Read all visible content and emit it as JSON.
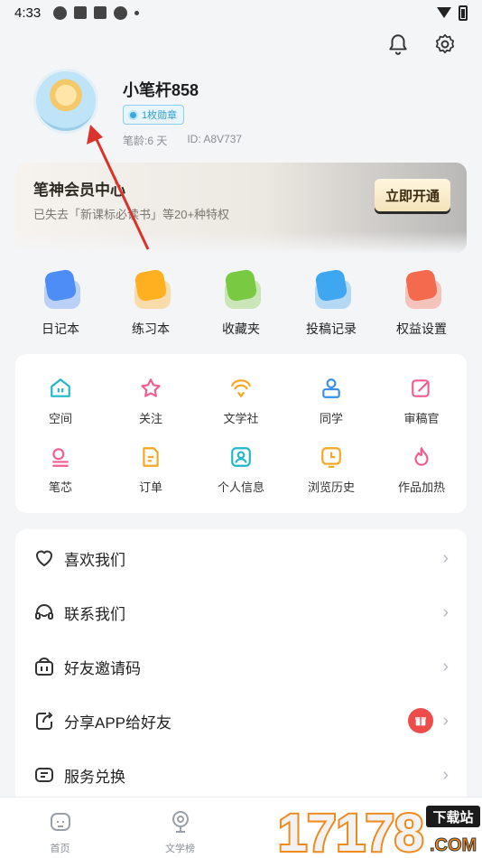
{
  "status_bar": {
    "time": "4:33"
  },
  "profile": {
    "username": "小笔杆858",
    "badge": "1枚勋章",
    "age": "笔龄:6 天",
    "id": "ID: A8V737"
  },
  "vip": {
    "title": "笔神会员中心",
    "subtitle": "已失去「新课标必读书」等20+种特权",
    "button": "立即开通"
  },
  "quick_actions": [
    {
      "label": "日记本",
      "icon": "diary-icon",
      "color": "#4d8df5"
    },
    {
      "label": "练习本",
      "icon": "exercise-book-icon",
      "color": "#ffb020"
    },
    {
      "label": "收藏夹",
      "icon": "favorites-icon",
      "color": "#7ac943"
    },
    {
      "label": "投稿记录",
      "icon": "submission-record-icon",
      "color": "#3fa6f0"
    },
    {
      "label": "权益设置",
      "icon": "benefits-icon",
      "color": "#f46a4e"
    }
  ],
  "grid_items": [
    {
      "label": "空间",
      "icon": "space-icon",
      "color": "#1fb8c9"
    },
    {
      "label": "关注",
      "icon": "follow-star-icon",
      "color": "#f25d8e"
    },
    {
      "label": "文学社",
      "icon": "literary-club-icon",
      "color": "#f5a623"
    },
    {
      "label": "同学",
      "icon": "classmates-icon",
      "color": "#3a8ee6"
    },
    {
      "label": "审稿官",
      "icon": "reviewer-icon",
      "color": "#f25d8e"
    },
    {
      "label": "笔芯",
      "icon": "pen-refill-icon",
      "color": "#f25d8e"
    },
    {
      "label": "订单",
      "icon": "order-icon",
      "color": "#f5a623"
    },
    {
      "label": "个人信息",
      "icon": "personal-info-icon",
      "color": "#1fb8c9"
    },
    {
      "label": "浏览历史",
      "icon": "history-icon",
      "color": "#f5a623"
    },
    {
      "label": "作品加热",
      "icon": "boost-flame-icon",
      "color": "#f25d8e"
    }
  ],
  "list_items": [
    {
      "label": "喜欢我们",
      "icon": "heart-icon"
    },
    {
      "label": "联系我们",
      "icon": "headset-icon"
    },
    {
      "label": "好友邀请码",
      "icon": "invite-code-icon"
    },
    {
      "label": "分享APP给好友",
      "icon": "share-icon"
    },
    {
      "label": "服务兑换",
      "icon": "redeem-icon"
    }
  ],
  "tabs": [
    {
      "label": "首页",
      "icon": "home-icon"
    },
    {
      "label": "文学榜",
      "icon": "trophy-icon"
    }
  ],
  "watermark": {
    "number": "17178",
    "tag": "下载站",
    "domain": ".COM"
  }
}
